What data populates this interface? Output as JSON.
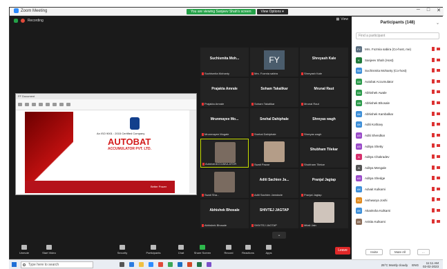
{
  "window": {
    "app_title": "Zoom Meeting",
    "share_message": "You are viewing Sanjeev Shah's screen",
    "view_options": "View Options",
    "meeting_status": "Recording",
    "view_label": "View"
  },
  "shared_screen": {
    "file_tab": "FF Document",
    "iso_text": "An ISO 9001 : 2015 Certified Company",
    "brand": "AUTOBAT",
    "brand_sub": "ACCUMULATOR PVT. LTD.",
    "footer_text": "Better Power"
  },
  "video_tiles": [
    {
      "name": "Suchismita Moh...",
      "label": "Suchismita Mohanty",
      "type": "name"
    },
    {
      "name": "FY",
      "label": "Mrs. Fozmia sabira",
      "type": "initials"
    },
    {
      "name": "Shreyash Kale",
      "label": "Shreyash Kale",
      "type": "name"
    },
    {
      "name": "Prajakta Amrale",
      "label": "Prajakta Amrale",
      "type": "name"
    },
    {
      "name": "Soham Takalikar",
      "label": "Soham Takalikar",
      "type": "name"
    },
    {
      "name": "Mrunal Raut",
      "label": "Mrunal Raut",
      "type": "name"
    },
    {
      "name": "Mrunmayee Mo...",
      "label": "Mrunmayee Mogale",
      "type": "name"
    },
    {
      "name": "Snehal Dahiphale",
      "label": "Snehal Dahiphale",
      "type": "name"
    },
    {
      "name": "Shreyas wagh",
      "label": "Shreyas wagh",
      "type": "name"
    },
    {
      "name": "",
      "label": "Autobat ACCUMULATOR",
      "type": "video"
    },
    {
      "name": "",
      "label": "Swati Pawar",
      "type": "video"
    },
    {
      "name": "Shubham Tilekar",
      "label": "Shubham Tilekar",
      "type": "name"
    },
    {
      "name": "",
      "label": "Swati Sha...",
      "type": "video"
    },
    {
      "name": "Aditi Sachien Ja...",
      "label": "Aditi Sachien Jamdade",
      "type": "name"
    },
    {
      "name": "Pranjal Jagtap",
      "label": "Pranjal Jagtap",
      "type": "name"
    },
    {
      "name": "Abhishek Bhosale",
      "label": "Abhishek Bhosale",
      "type": "name"
    },
    {
      "name": "SHIVTEJ JAGTAP",
      "label": "SHIVTEJ JAGTAP",
      "type": "name"
    },
    {
      "name": "",
      "label": "Mitali Jain",
      "type": "video"
    }
  ],
  "participants": {
    "title": "Participants (148)",
    "search_placeholder": "Find a participant",
    "list": [
      {
        "initials": "FY",
        "name": "Mrs. Fozmia sabira (Co-host, me)",
        "color": "#5b6f80"
      },
      {
        "initials": "K",
        "name": "Sanjeev Shah (Host)",
        "color": "#1f7a3a"
      },
      {
        "initials": "SM",
        "name": "Suchismita Mohanty (Co-host)",
        "color": "#3e8fd8"
      },
      {
        "initials": "AA",
        "name": "Autobat Accumulator",
        "color": "#2d9a4c"
      },
      {
        "initials": "AA",
        "name": "Abhishek Awale",
        "color": "#2d9a4c"
      },
      {
        "initials": "AB",
        "name": "Abhishek Bhosale",
        "color": "#2d9a4c"
      },
      {
        "initials": "AK",
        "name": "Abhishek Kambalkar",
        "color": "#3e8fd8"
      },
      {
        "initials": "AK",
        "name": "Aditi Kothavy",
        "color": "#3e8fd8"
      },
      {
        "initials": "AS",
        "name": "Aditi Shendkar",
        "color": "#9a4cc8"
      },
      {
        "initials": "AS",
        "name": "Aditya  Shetty",
        "color": "#9a4cc8"
      },
      {
        "initials": "A",
        "name": "Aditya Chakradev",
        "color": "#d6306c"
      },
      {
        "initials": "A",
        "name": "Aditya Mengale",
        "color": "#555555"
      },
      {
        "initials": "AS",
        "name": "Aditya Shedge",
        "color": "#9a4cc8"
      },
      {
        "initials": "AK",
        "name": "Advait Kulkarni",
        "color": "#3e8fd8"
      },
      {
        "initials": "AJ",
        "name": "Aishwarya Joshi",
        "color": "#e08a1e"
      },
      {
        "initials": "AK",
        "name": "Akanksha Kulkarni",
        "color": "#3e8fd8"
      },
      {
        "initials": "AK",
        "name": "Ankita Kulkarni",
        "color": "#8a6d5a"
      }
    ],
    "invite_label": "Invite",
    "mute_all_label": "Mute All",
    "more_label": "..."
  },
  "controls": [
    {
      "label": "Unmute"
    },
    {
      "label": "Start Video"
    },
    {
      "label": "Security"
    },
    {
      "label": "Participants"
    },
    {
      "label": "Chat"
    },
    {
      "label": "Share Screen"
    },
    {
      "label": "Record"
    },
    {
      "label": "Reactions"
    },
    {
      "label": "Apps"
    }
  ],
  "participants_count_badge": "148",
  "leave_label": "Leave",
  "taskbar": {
    "search_placeholder": "Type here to search",
    "weather": "25°C  Mostly cloudy",
    "lang": "ENG",
    "time": "11:11 AM",
    "date": "02-02-2023"
  }
}
